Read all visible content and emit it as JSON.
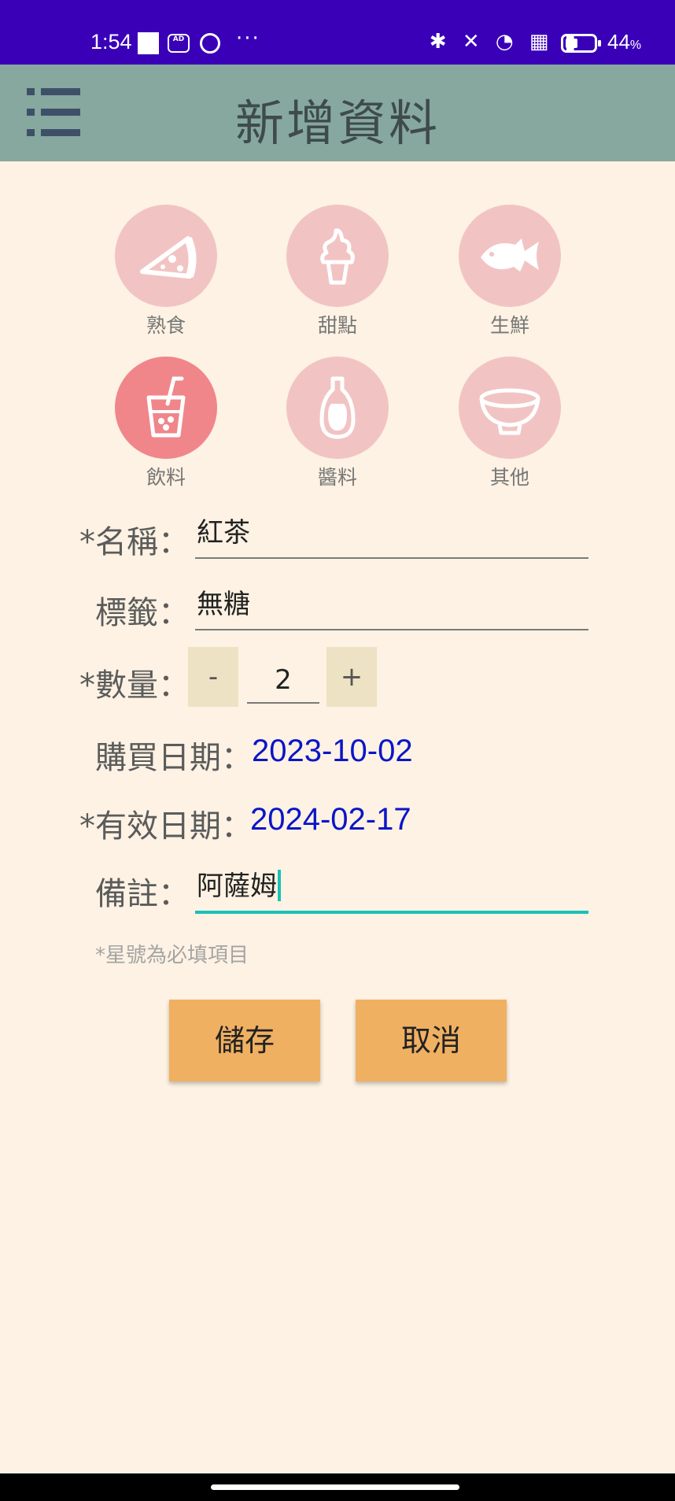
{
  "status_bar": {
    "time": "1:54",
    "ad_icon_text": "AD",
    "right_icons": "✱ ✕ ◔ ▦ ▮",
    "battery_percent": 44,
    "battery_text": "44",
    "battery_unit": "%"
  },
  "app_bar": {
    "title": "新增資料",
    "menu_icon": "list-menu-icon"
  },
  "categories": [
    {
      "label": "熟食",
      "icon": "pizza-icon",
      "selected": false
    },
    {
      "label": "甜點",
      "icon": "ice-cream-icon",
      "selected": false
    },
    {
      "label": "生鮮",
      "icon": "fish-icon",
      "selected": false
    },
    {
      "label": "飲料",
      "icon": "drink-cup-icon",
      "selected": true
    },
    {
      "label": "醬料",
      "icon": "sauce-bottle-icon",
      "selected": false
    },
    {
      "label": "其他",
      "icon": "bowl-icon",
      "selected": false
    }
  ],
  "form": {
    "name_label": "*名稱：",
    "name_value": "紅茶",
    "tag_label": "標籤：",
    "tag_value": "無糖",
    "quantity_label": "*數量：",
    "quantity_minus": "-",
    "quantity_value": "2",
    "quantity_plus": "+",
    "purchase_date_label": "購買日期：",
    "purchase_date_value": "2023-10-02",
    "expiry_date_label": "*有效日期：",
    "expiry_date_value": "2024-02-17",
    "note_label": "備註：",
    "note_value": "阿薩姆",
    "required_hint": "*星號為必填項目"
  },
  "actions": {
    "save_label": "儲存",
    "cancel_label": "取消"
  },
  "colors": {
    "status_bar": "#3a00b8",
    "app_bar": "#86a89f",
    "background": "#fdf2e3",
    "category_circle": "#f1c4c3",
    "category_selected": "#f0868a",
    "date_text": "#0a15c8",
    "button": "#f0b062",
    "focus_underline": "#19c1b8"
  }
}
